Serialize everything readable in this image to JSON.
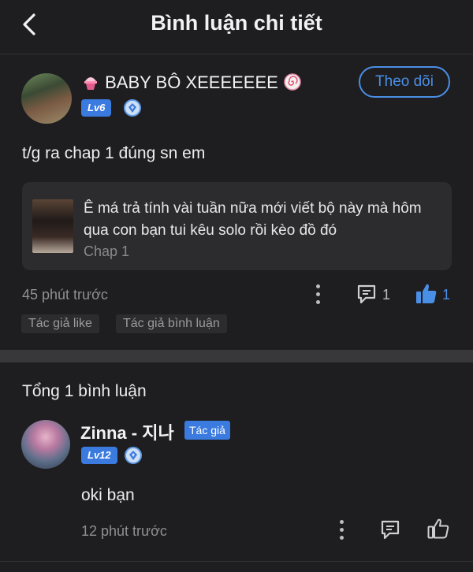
{
  "header": {
    "title": "Bình luận chi tiết"
  },
  "post": {
    "username": "BABY BÔ XEEEEEEE",
    "level": "Lv6",
    "follow_label": "Theo dõi",
    "text": "t/g ra chap 1 đúng sn em",
    "quote": {
      "text": "Ê má trả tính vài tuần nữa mới viết bộ này mà hôm qua con bạn tui kêu solo rồi kèo đồ đó",
      "chapter": "Chap 1"
    },
    "time": "45 phút trước",
    "reply_count": "1",
    "like_count": "1",
    "tags": [
      "Tác giả like",
      "Tác giả bình luận"
    ]
  },
  "replies_header": "Tổng 1 bình luận",
  "reply": {
    "username": "Zinna - 지나",
    "author_badge": "Tác giả",
    "level": "Lv12",
    "text": "oki bạn",
    "time": "12 phút trước"
  },
  "colors": {
    "accent": "#3b7be0",
    "like_active": "#4a8fe6",
    "background": "#1e1e20"
  },
  "icons": [
    "back-arrow-icon",
    "shaved-ice-emoji-icon",
    "fish-cake-emoji-icon",
    "level-gem-icon",
    "more-dots-icon",
    "comment-icon",
    "thumbs-up-icon"
  ]
}
